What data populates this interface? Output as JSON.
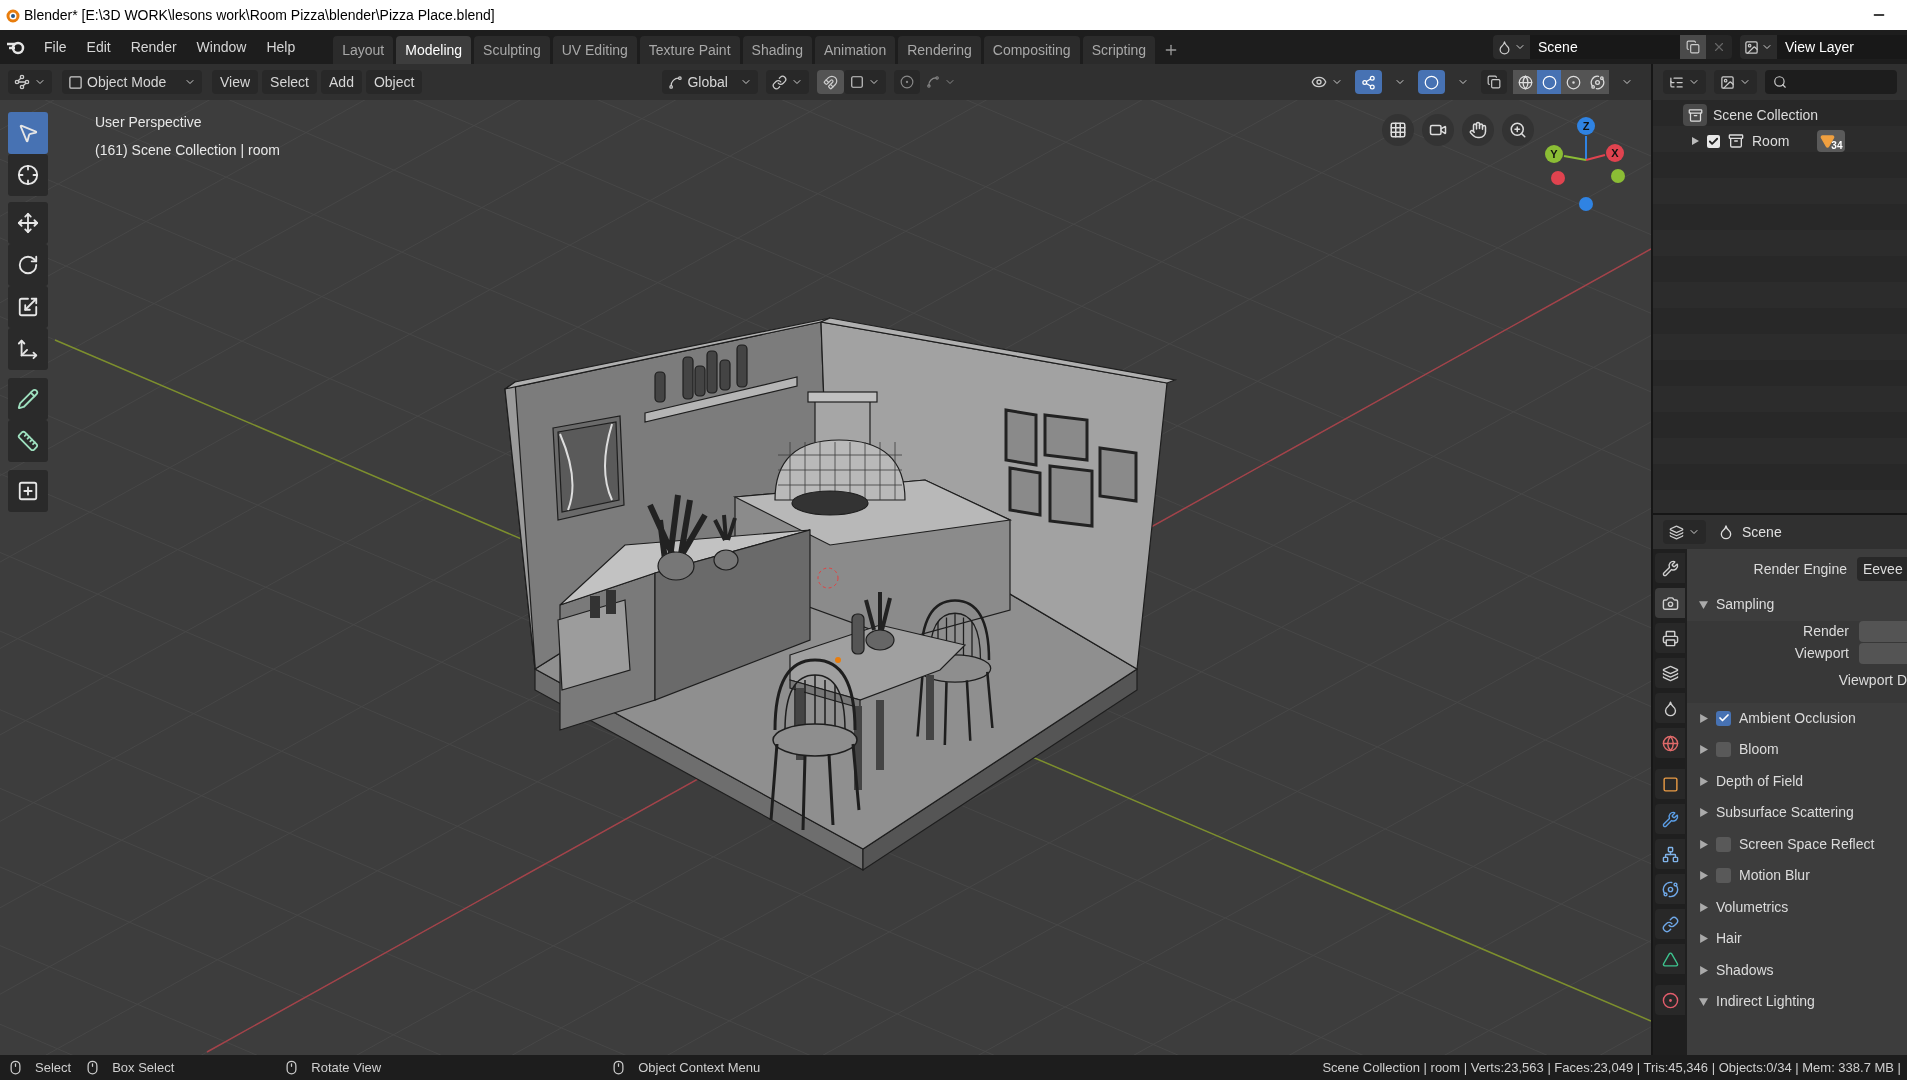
{
  "window": {
    "title": "Blender* [E:\\3D WORK\\lesons work\\Room Pizza\\blender\\Pizza Place.blend]"
  },
  "menu": [
    "File",
    "Edit",
    "Render",
    "Window",
    "Help"
  ],
  "workspace_tabs": [
    {
      "label": "Layout",
      "selected": false
    },
    {
      "label": "Modeling",
      "selected": true
    },
    {
      "label": "Sculpting",
      "selected": false
    },
    {
      "label": "UV Editing",
      "selected": false
    },
    {
      "label": "Texture Paint",
      "selected": false
    },
    {
      "label": "Shading",
      "selected": false
    },
    {
      "label": "Animation",
      "selected": false
    },
    {
      "label": "Rendering",
      "selected": false
    },
    {
      "label": "Compositing",
      "selected": false
    },
    {
      "label": "Scripting",
      "selected": false
    }
  ],
  "scene": {
    "label": "Scene"
  },
  "view_layer": {
    "label": "View Layer"
  },
  "viewport_header": {
    "mode": "Object Mode",
    "menus": [
      "View",
      "Select",
      "Add",
      "Object"
    ],
    "orientation": "Global",
    "gizmos_on": true,
    "overlays_on": true,
    "shading_modes": [
      {
        "selected": false
      },
      {
        "selected": true
      },
      {
        "selected": false
      },
      {
        "selected": false
      }
    ]
  },
  "toolbar": [
    {
      "selected": true
    },
    {
      "selected": false
    },
    {
      "selected": false
    },
    {
      "selected": false
    },
    {
      "selected": false
    },
    {
      "selected": false
    },
    {
      "selected": false
    },
    {
      "selected": false
    },
    {
      "selected": false
    }
  ],
  "viewport": {
    "view_name": "User Perspective",
    "context": "(161) Scene Collection | room",
    "gizmo_axes": [
      "Z",
      "Y",
      "X"
    ]
  },
  "outliner": {
    "items": [
      {
        "label": "Scene Collection",
        "children": [
          {
            "label": "Room",
            "checked": true,
            "expanded": false,
            "badge": "34"
          }
        ]
      }
    ]
  },
  "properties": {
    "context": "Scene",
    "tabs": [
      {
        "selected": false
      },
      {
        "selected": true
      },
      {
        "selected": false
      },
      {
        "selected": false
      },
      {
        "selected": false
      },
      {
        "selected": false
      },
      {
        "selected": false
      },
      {
        "selected": false
      },
      {
        "selected": false
      },
      {
        "selected": false
      },
      {
        "selected": false
      },
      {
        "selected": false
      },
      {
        "selected": false
      }
    ],
    "render_engine": {
      "label": "Render Engine",
      "value": "Eevee"
    },
    "sections": [
      {
        "kind": "plain",
        "label": "Sampling",
        "expanded": true,
        "fields": [
          {
            "label": "Render"
          },
          {
            "label": "Viewport"
          }
        ],
        "note": "Viewport D"
      },
      {
        "kind": "toggle",
        "label": "Ambient Occlusion",
        "expanded": false,
        "checked": true
      },
      {
        "kind": "toggle",
        "label": "Bloom",
        "expanded": false,
        "checked": false
      },
      {
        "kind": "plain",
        "label": "Depth of Field",
        "expanded": false
      },
      {
        "kind": "plain",
        "label": "Subsurface Scattering",
        "expanded": false
      },
      {
        "kind": "toggle",
        "label": "Screen Space Reflect",
        "expanded": false,
        "checked": false
      },
      {
        "kind": "toggle",
        "label": "Motion Blur",
        "expanded": false,
        "checked": false
      },
      {
        "kind": "plain",
        "label": "Volumetrics",
        "expanded": false
      },
      {
        "kind": "plain",
        "label": "Hair",
        "expanded": false
      },
      {
        "kind": "plain",
        "label": "Shadows",
        "expanded": false
      },
      {
        "kind": "plain",
        "label": "Indirect Lighting",
        "expanded": true
      }
    ]
  },
  "status_bar": {
    "hints": [
      {
        "label": "Select"
      },
      {
        "label": "Box Select"
      },
      {
        "label": "Rotate View"
      },
      {
        "label": "Object Context Menu"
      }
    ],
    "stats": "Scene Collection | room | Verts:23,563 | Faces:23,049 | Tris:45,346 | Objects:0/34 | Mem: 338.7 MB |"
  }
}
